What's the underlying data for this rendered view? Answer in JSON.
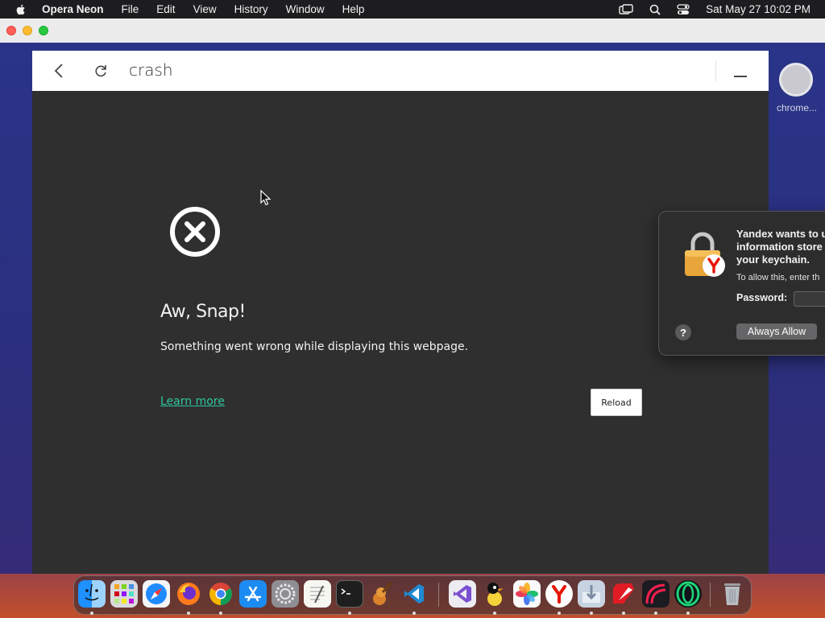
{
  "menubar": {
    "app_name": "Opera Neon",
    "menus": [
      "File",
      "Edit",
      "View",
      "History",
      "Window",
      "Help"
    ],
    "clock": "Sat May 27  10:02 PM"
  },
  "browser": {
    "url_text": "crash",
    "side_label": "chrome..."
  },
  "error_page": {
    "title": "Aw, Snap!",
    "message": "Something went wrong while displaying this webpage.",
    "learn_more": "Learn more",
    "reload": "Reload"
  },
  "keychain_dialog": {
    "title": "Yandex wants to u\ninformation store\nyour keychain.",
    "subtitle": "To allow this, enter th",
    "password_label": "Password:",
    "password_value": "",
    "help": "?",
    "allow_button": "Always Allow"
  },
  "dock": {
    "apps": [
      "Finder",
      "Launchpad",
      "Safari",
      "Firefox",
      "Chrome",
      "App Store",
      "System Preferences",
      "TextEdit",
      "Terminal",
      "GarageBand",
      "Visual Studio Code",
      "Visual Studio",
      "Cyberduck",
      "Photos",
      "Yandex",
      "Downloads",
      "Opera Neon",
      "Opera GX",
      "Opera",
      "Trash"
    ]
  },
  "colors": {
    "content_bg": "#2f2f30",
    "link": "#2fc79a",
    "yandex_red": "#e61400"
  }
}
